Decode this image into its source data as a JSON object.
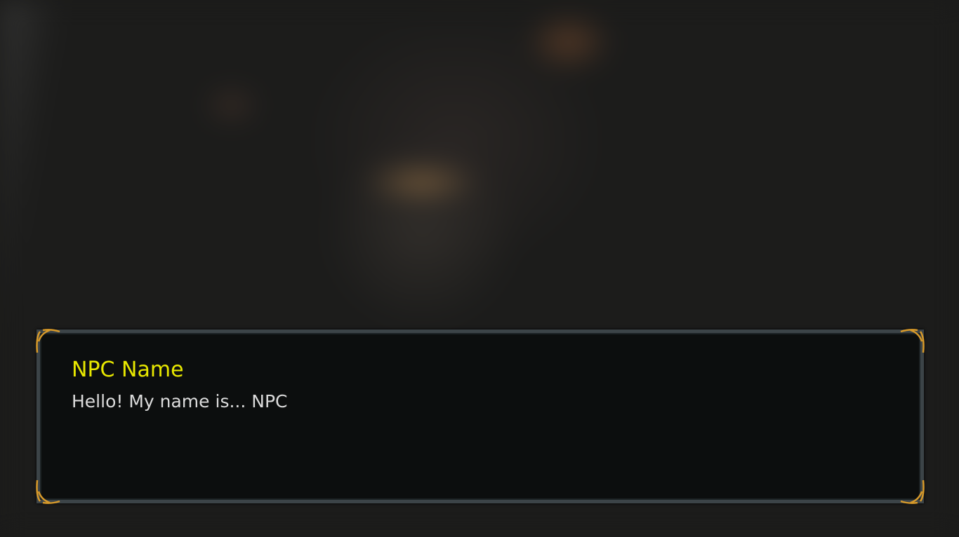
{
  "dialog": {
    "speaker_name": "NPC Name",
    "message": "Hello! My name is... NPC",
    "name_color": "#e8e800",
    "text_color": "#dcdcdc",
    "ornament_color": "#d89a2a"
  }
}
